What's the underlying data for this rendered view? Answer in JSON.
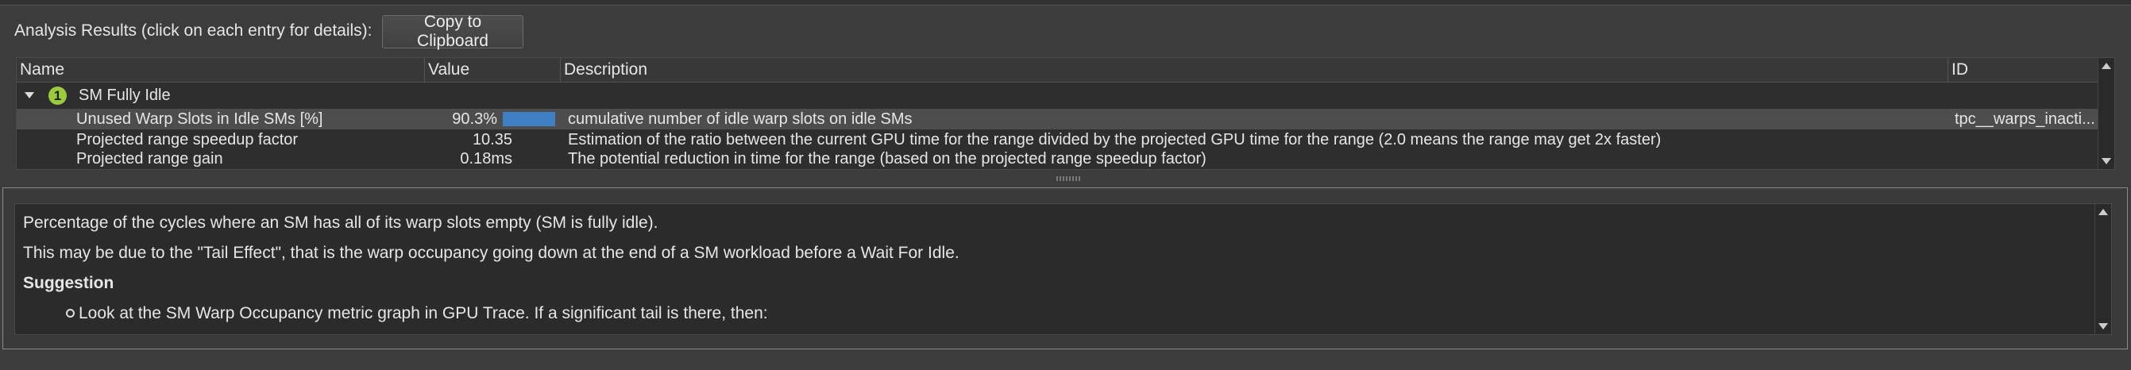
{
  "header": {
    "label": "Analysis Results (click on each entry for details):",
    "copy_button": "Copy to Clipboard"
  },
  "table": {
    "columns": [
      "Name",
      "Value",
      "Description",
      "ID"
    ],
    "group": {
      "number": "1",
      "label": "SM Fully Idle"
    },
    "rows": [
      {
        "name": "Unused Warp Slots in Idle SMs [%]",
        "value": "90.3%",
        "bar_fraction": 0.903,
        "description": "cumulative number of idle warp slots on idle SMs",
        "id": "tpc__warps_inacti..."
      },
      {
        "name": "Projected range speedup factor",
        "value": "10.35",
        "description": "Estimation of the ratio between the current GPU time for the range divided by the projected GPU time for the range (2.0 means the range may get 2x faster)",
        "id": ""
      },
      {
        "name": "Projected range gain",
        "value": "0.18ms",
        "description": "The potential reduction in time for the range (based on the projected range speedup factor)",
        "id": ""
      }
    ]
  },
  "details": {
    "line1": "Percentage of the cycles where an SM has all of its warp slots empty (SM is fully idle).",
    "line2": "This may be due to the \"Tail Effect\", that is the warp occupancy going down at the end of a SM workload before a Wait For Idle.",
    "suggestion_heading": "Suggestion",
    "bullet1": "Look at the SM Warp Occupancy metric graph in GPU Trace. If a significant tail is there, then:"
  },
  "colors": {
    "bar": "#3f7fc4",
    "badge": "#9bcb3c",
    "selected_row": "#4d4d4d"
  }
}
